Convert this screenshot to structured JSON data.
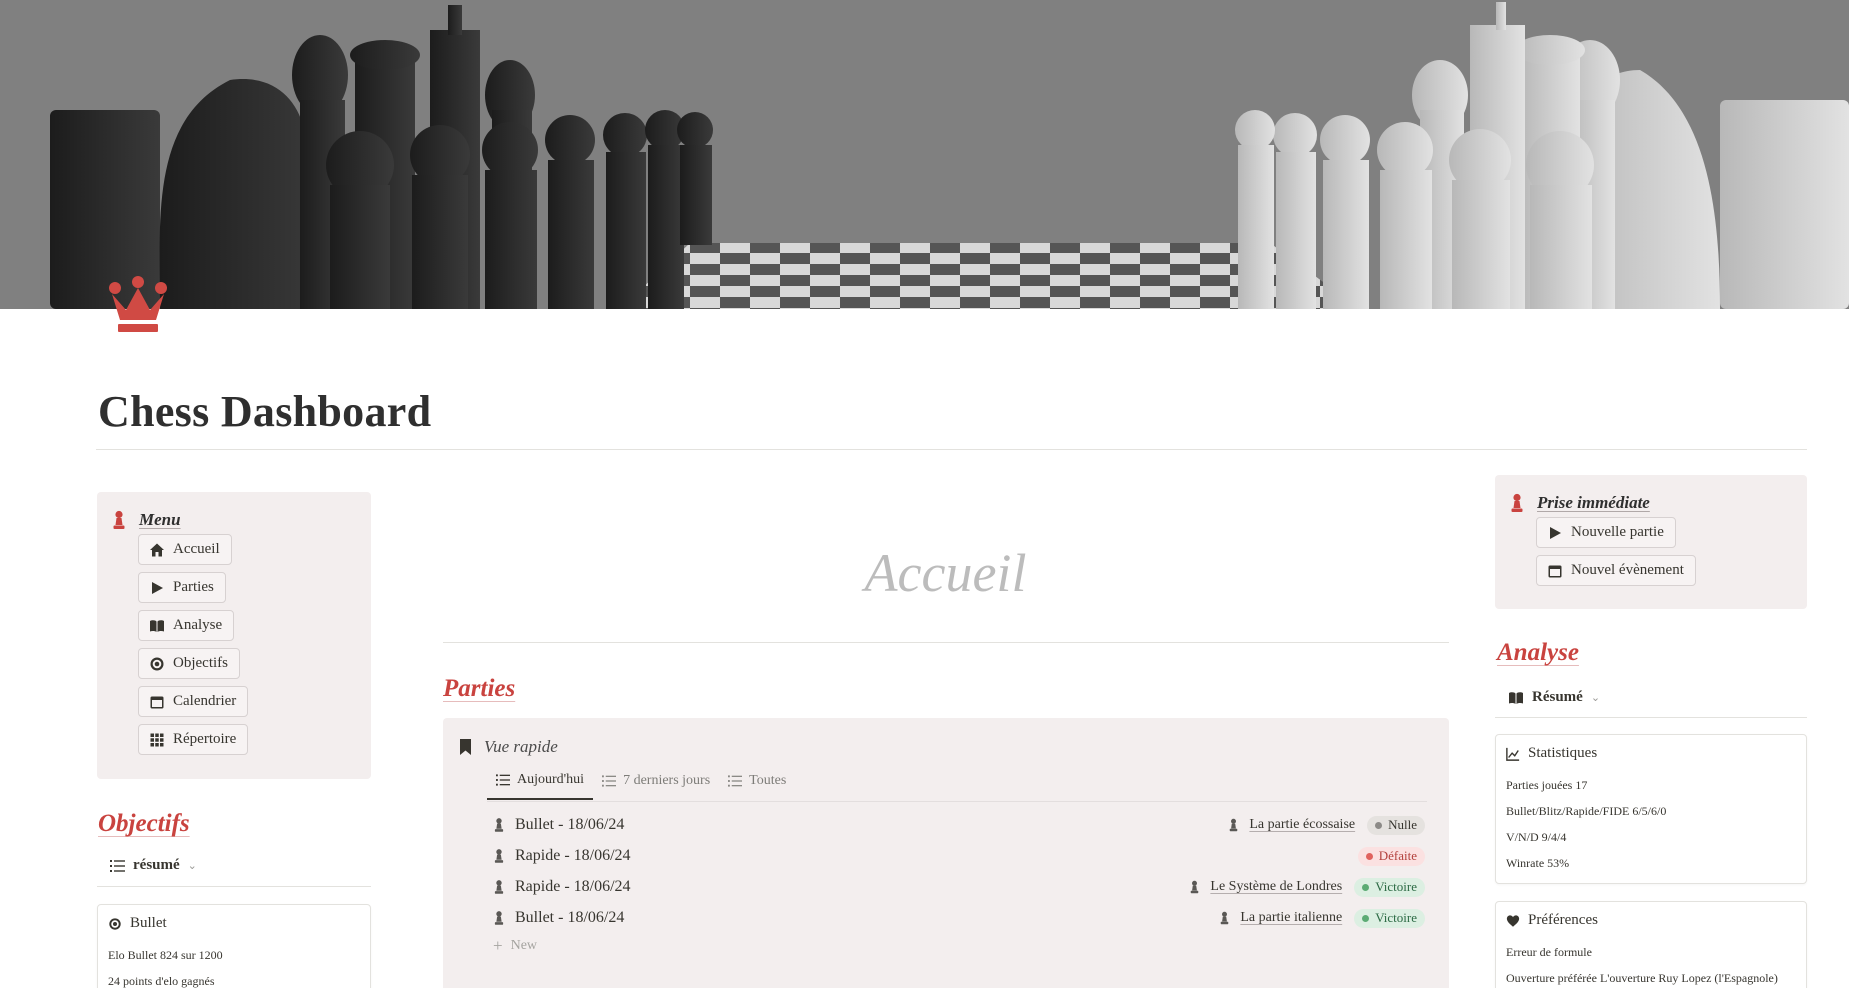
{
  "page": {
    "title": "Chess Dashboard",
    "subtitle": "Accueil"
  },
  "colors": {
    "accent": "#c9433f",
    "callout_bg": "#f3eeee",
    "tag_victoire": "#dcefe2",
    "tag_defaite": "#fbe1e1",
    "tag_nulle": "#e5e2df"
  },
  "icons": {
    "page": "crown-icon",
    "callout": "pawn-icon"
  },
  "menu": {
    "title": "Menu",
    "items": [
      {
        "label": "Accueil",
        "icon": "home-icon"
      },
      {
        "label": "Parties",
        "icon": "play-icon"
      },
      {
        "label": "Analyse",
        "icon": "book-icon"
      },
      {
        "label": "Objectifs",
        "icon": "target-icon"
      },
      {
        "label": "Calendrier",
        "icon": "calendar-icon"
      },
      {
        "label": "Répertoire",
        "icon": "grid-icon"
      }
    ]
  },
  "objectifs": {
    "heading": "Objectifs",
    "view_label": "résumé",
    "card": {
      "title": "Bullet",
      "lines": [
        "Elo Bullet 824 sur 1200",
        "24 points d'elo gagnés"
      ]
    }
  },
  "parties": {
    "heading": "Parties",
    "view_title": "Vue rapide",
    "tabs": [
      {
        "label": "Aujourd'hui",
        "active": true
      },
      {
        "label": "7 derniers jours",
        "active": false
      },
      {
        "label": "Toutes",
        "active": false
      }
    ],
    "rows": [
      {
        "name": "Bullet - 18/06/24",
        "opening": "La partie écossaise",
        "result": "Nulle"
      },
      {
        "name": "Rapide - 18/06/24",
        "opening": "",
        "result": "Défaite"
      },
      {
        "name": "Rapide - 18/06/24",
        "opening": "Le Système de Londres",
        "result": "Victoire"
      },
      {
        "name": "Bullet - 18/06/24",
        "opening": "La partie italienne",
        "result": "Victoire"
      }
    ],
    "new_label": "New"
  },
  "quick": {
    "title": "Prise immédiate",
    "buttons": [
      {
        "label": "Nouvelle partie",
        "icon": "play-icon"
      },
      {
        "label": "Nouvel évènement",
        "icon": "calendar-icon"
      }
    ]
  },
  "analyse": {
    "heading": "Analyse",
    "view_label": "Résumé",
    "stats": {
      "title": "Statistiques",
      "lines": [
        "Parties jouées 17",
        "Bullet/Blitz/Rapide/FIDE 6/5/6/0",
        "V/N/D 9/4/4",
        "Winrate 53%"
      ]
    },
    "prefs": {
      "title": "Préférences",
      "lines": [
        "Erreur de formule",
        "Ouverture préférée L'ouverture Ruy Lopez (l'Espagnole)"
      ]
    }
  }
}
